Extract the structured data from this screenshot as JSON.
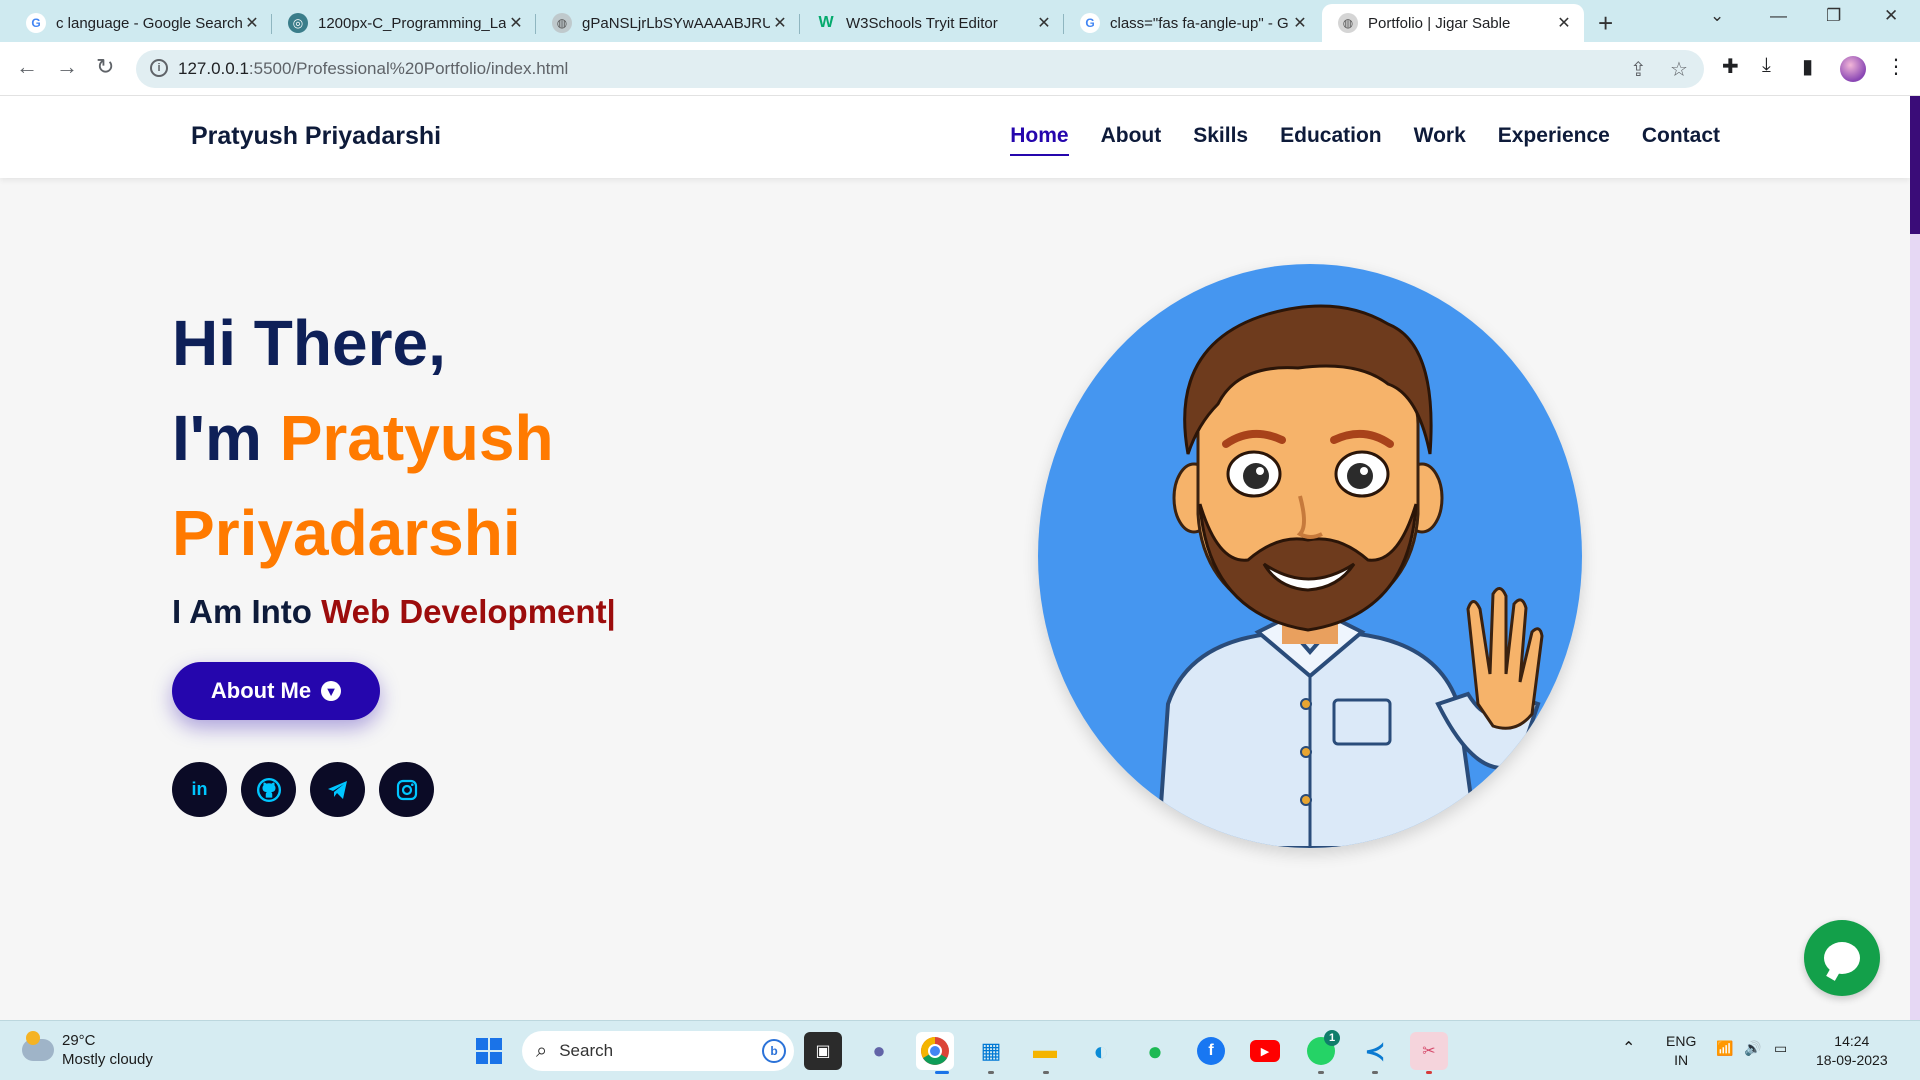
{
  "browser": {
    "tabs": [
      {
        "title": "c language - Google Search",
        "icon": "google-icon"
      },
      {
        "title": "1200px-C_Programming_La",
        "icon": "wikimedia-icon"
      },
      {
        "title": "gPaNSLjrLbSYwAAAABJRU5",
        "icon": "globe-icon"
      },
      {
        "title": "W3Schools Tryit Editor",
        "icon": "w3schools-icon"
      },
      {
        "title": "class=\"fas fa-angle-up\" - G",
        "icon": "google-icon"
      },
      {
        "title": "Portfolio | Jigar Sable",
        "icon": "globe-icon",
        "active": true
      }
    ],
    "url_host": "127.0.0.1",
    "url_path": ":5500/Professional%20Portfolio/index.html"
  },
  "site": {
    "brand": "Pratyush Priyadarshi",
    "nav": [
      "Home",
      "About",
      "Skills",
      "Education",
      "Work",
      "Experience",
      "Contact"
    ],
    "active_nav": "Home"
  },
  "hero": {
    "greeting": "Hi There,",
    "im": "I'm ",
    "first_name": "Pratyush",
    "last_name": "Priyadarshi",
    "into_prefix": "I Am Into ",
    "into_value": "Web Development|",
    "button_label": "About Me",
    "socials": [
      "linkedin-icon",
      "github-icon",
      "telegram-icon",
      "instagram-icon"
    ]
  },
  "taskbar": {
    "weather_temp": "29°C",
    "weather_desc": "Mostly cloudy",
    "search_placeholder": "Search",
    "lang": "ENG",
    "region": "IN",
    "time": "14:24",
    "date": "18-09-2023",
    "whatsapp_badge": "1"
  },
  "colors": {
    "accent_blue": "#2506ad",
    "accent_orange": "#ff7a00",
    "accent_red": "#9c0c0c",
    "navy": "#0e2058",
    "avatar_bg": "#4596f0",
    "chat_green": "#13a04a"
  }
}
